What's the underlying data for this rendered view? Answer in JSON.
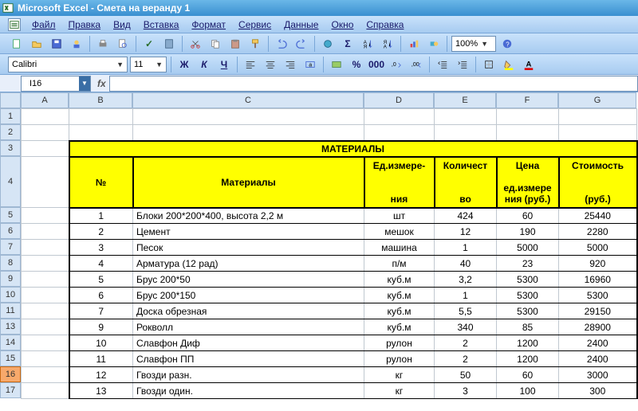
{
  "app": {
    "title": "Microsoft Excel - Смета на веранду 1"
  },
  "menu": {
    "items": [
      "Файл",
      "Правка",
      "Вид",
      "Вставка",
      "Формат",
      "Сервис",
      "Данные",
      "Окно",
      "Справка"
    ]
  },
  "toolbar1": {
    "zoom": "100%"
  },
  "toolbar2": {
    "font": "Calibri",
    "size": "11"
  },
  "namebox": {
    "ref": "I16"
  },
  "columns": [
    "A",
    "B",
    "C",
    "D",
    "E",
    "F",
    "G"
  ],
  "rows_visible": [
    "1",
    "2",
    "3",
    "4",
    "5",
    "6",
    "7",
    "8",
    "9",
    "10",
    "11",
    "13",
    "14",
    "15",
    "16",
    "17"
  ],
  "selected_row": "16",
  "section_title": "МАТЕРИАЛЫ",
  "headers": {
    "num": "№",
    "material": "Материалы",
    "unit_l1": "Ед.измере-",
    "unit_l2": "ния",
    "qty_l1": "Количест",
    "qty_l2": "во",
    "price_l1": "Цена",
    "price_l2": "ед.измере",
    "price_l3": "ния (руб.)",
    "cost_l1": "Стоимость",
    "cost_l2": "(руб.)"
  },
  "data_rows": [
    {
      "n": "1",
      "mat": "Блоки 200*200*400, высота 2,2 м",
      "unit": "шт",
      "qty": "424",
      "price": "60",
      "cost": "25440"
    },
    {
      "n": "2",
      "mat": "Цемент",
      "unit": "мешок",
      "qty": "12",
      "price": "190",
      "cost": "2280"
    },
    {
      "n": "3",
      "mat": "Песок",
      "unit": "машина",
      "qty": "1",
      "price": "5000",
      "cost": "5000"
    },
    {
      "n": "4",
      "mat": "Арматура (12 рад)",
      "unit": "п/м",
      "qty": "40",
      "price": "23",
      "cost": "920"
    },
    {
      "n": "5",
      "mat": "Брус 200*50",
      "unit": "куб.м",
      "qty": "3,2",
      "price": "5300",
      "cost": "16960"
    },
    {
      "n": "6",
      "mat": "Брус 200*150",
      "unit": "куб.м",
      "qty": "1",
      "price": "5300",
      "cost": "5300"
    },
    {
      "n": "7",
      "mat": "Доска обрезная",
      "unit": "куб.м",
      "qty": "5,5",
      "price": "5300",
      "cost": "29150"
    },
    {
      "n": "9",
      "mat": "Рокволл",
      "unit": "куб.м",
      "qty": "340",
      "price": "85",
      "cost": "28900"
    },
    {
      "n": "10",
      "mat": "Славфон Диф",
      "unit": "рулон",
      "qty": "2",
      "price": "1200",
      "cost": "2400"
    },
    {
      "n": "11",
      "mat": "Славфон ПП",
      "unit": "рулон",
      "qty": "2",
      "price": "1200",
      "cost": "2400"
    },
    {
      "n": "12",
      "mat": "Гвозди разн.",
      "unit": "кг",
      "qty": "50",
      "price": "60",
      "cost": "3000"
    },
    {
      "n": "13",
      "mat": "Гвозди один.",
      "unit": "кг",
      "qty": "3",
      "price": "100",
      "cost": "300"
    }
  ]
}
